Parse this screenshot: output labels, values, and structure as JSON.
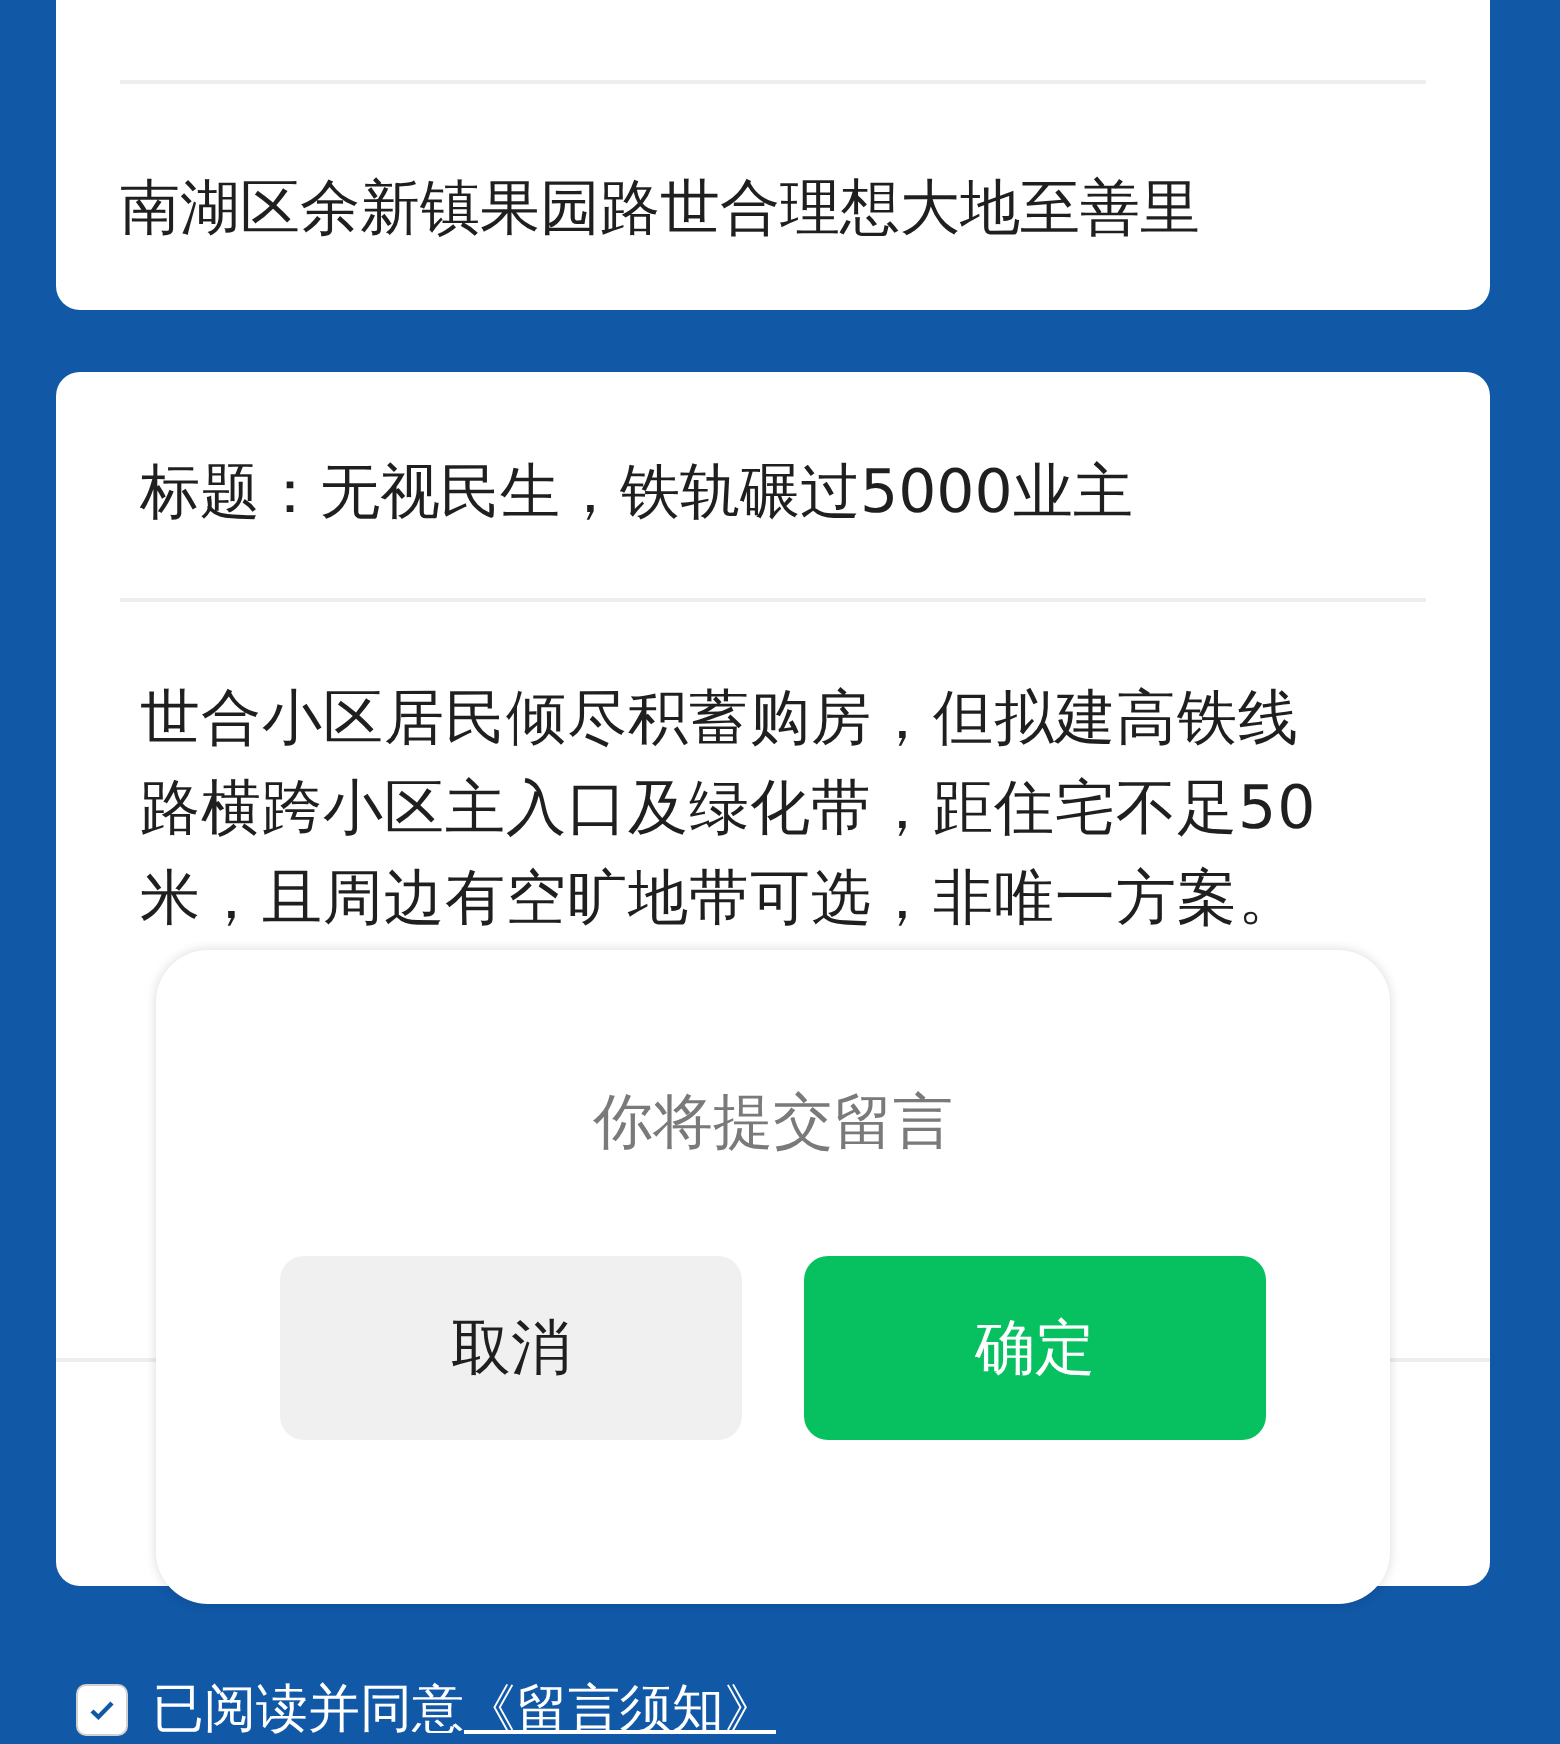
{
  "address_card": {
    "address": "南湖区余新镇果园路世合理想大地至善里"
  },
  "message_card": {
    "title": "标题：无视民生，铁轨碾过5000业主",
    "body_lines": [
      "世合小区居民倾尽积蓄购房，但拟建高铁线",
      "路横跨小区主入口及绿化带，距住宅不足50",
      "米，且周边有空旷地带可选，非唯一方案。"
    ]
  },
  "dialog": {
    "message": "你将提交留言",
    "buttons": [
      {
        "label": "取消",
        "kind": "cancel"
      },
      {
        "label": "确定",
        "kind": "confirm"
      }
    ]
  },
  "agreement": {
    "checked": true,
    "text": "已阅读并同意",
    "link": "《留言须知》"
  }
}
